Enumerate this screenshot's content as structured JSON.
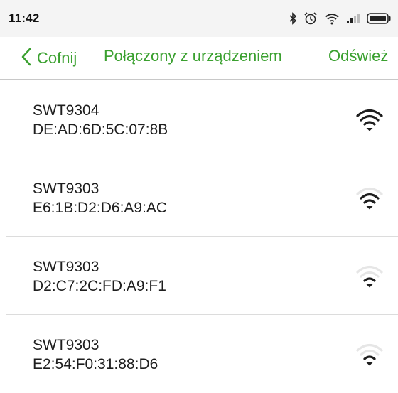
{
  "status_bar": {
    "time": "11:42",
    "icons": [
      "bluetooth-icon",
      "alarm-icon",
      "wifi-status-icon",
      "signal-icon",
      "battery-icon"
    ]
  },
  "app_bar": {
    "back_label": "Cofnij",
    "title": "Połączony z urządzeniem",
    "refresh_label": "Odśwież",
    "accent_color": "#3aa02f"
  },
  "devices": [
    {
      "name": "SWT9304",
      "mac": "DE:AD:6D:5C:07:8B",
      "signal_bars": 3,
      "signal_max": 3
    },
    {
      "name": "SWT9303",
      "mac": "E6:1B:D2:D6:A9:AC",
      "signal_bars": 2,
      "signal_max": 3
    },
    {
      "name": "SWT9303",
      "mac": "D2:C7:2C:FD:A9:F1",
      "signal_bars": 1,
      "signal_max": 3
    },
    {
      "name": "SWT9303",
      "mac": "E2:54:F0:31:88:D6",
      "signal_bars": 1,
      "signal_max": 3
    }
  ]
}
